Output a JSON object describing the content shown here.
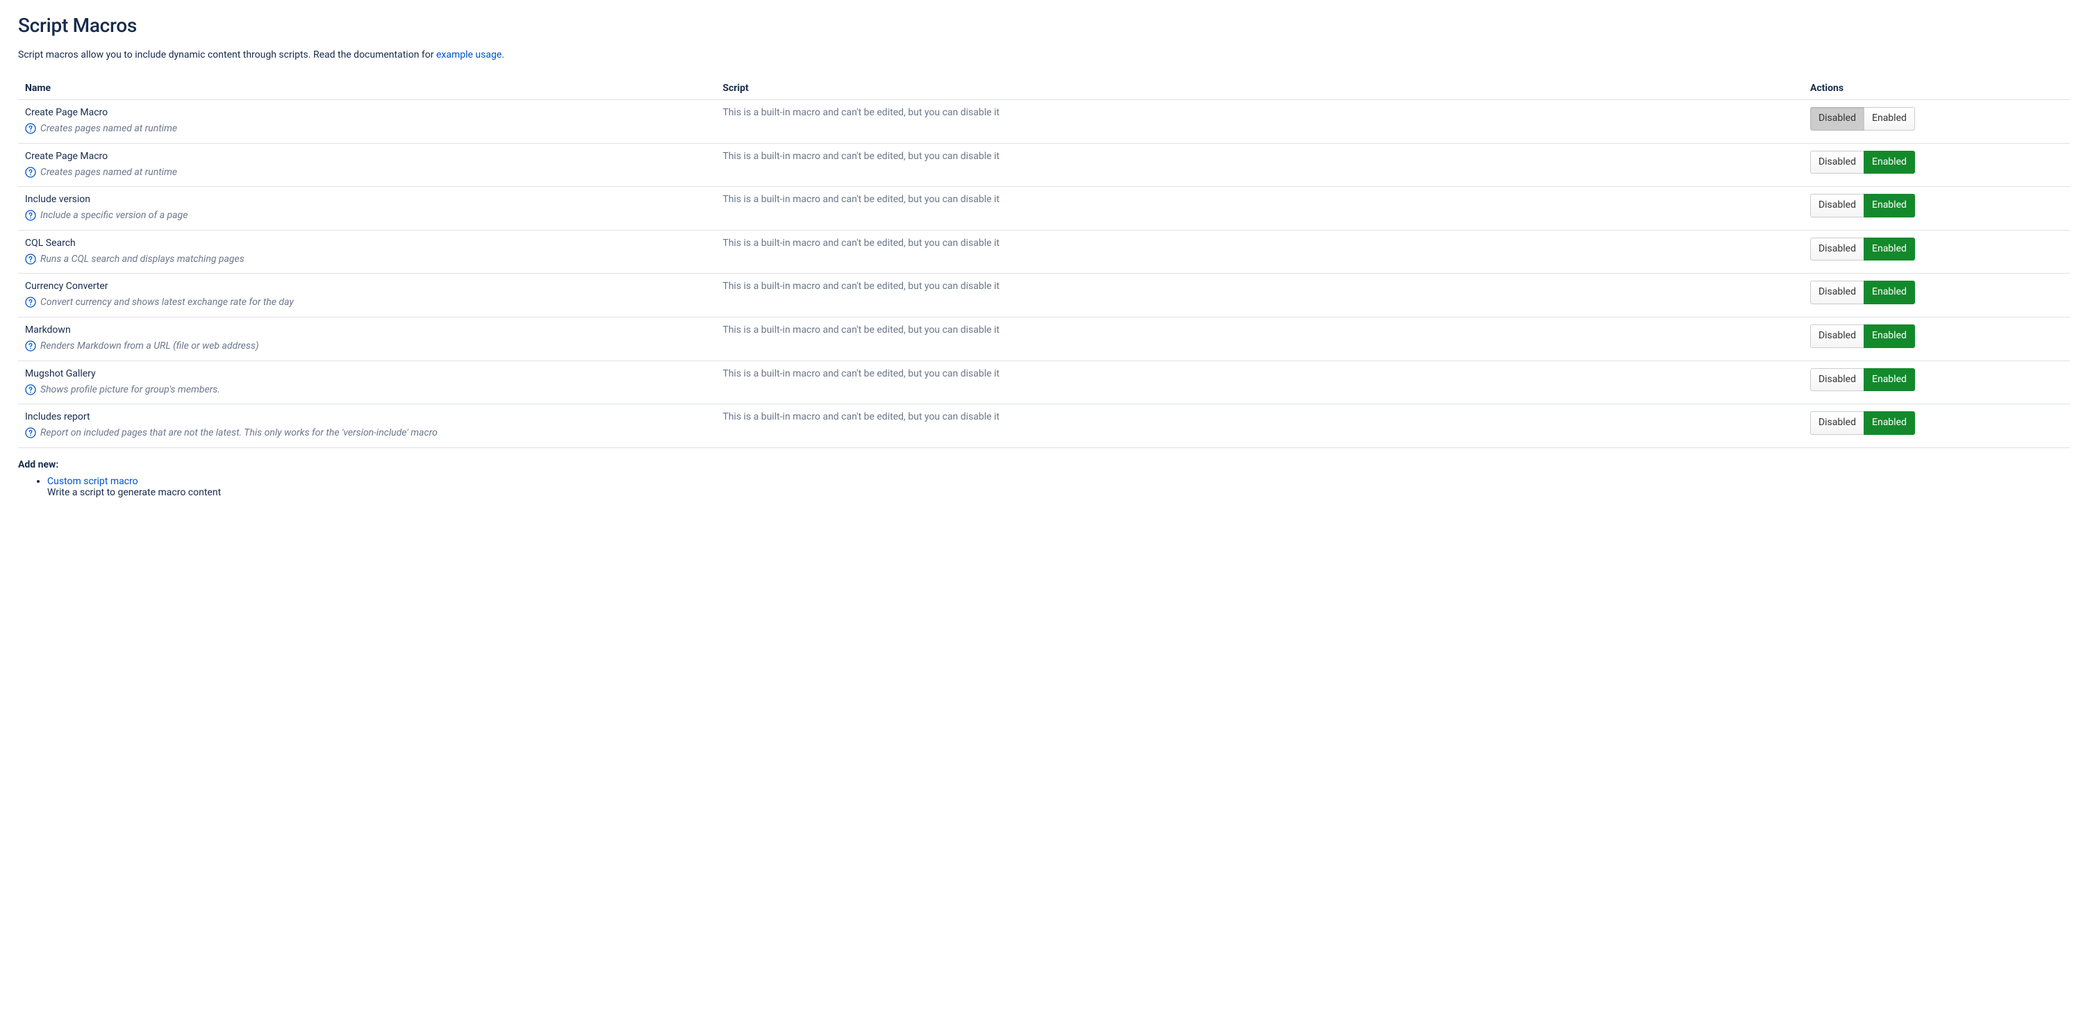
{
  "page": {
    "title": "Script Macros",
    "intro_prefix": "Script macros allow you to include dynamic content through scripts. Read the documentation for ",
    "intro_link": "example usage",
    "intro_suffix": "."
  },
  "columns": {
    "name": "Name",
    "script": "Script",
    "actions": "Actions"
  },
  "buttons": {
    "disabled": "Disabled",
    "enabled": "Enabled"
  },
  "macros": [
    {
      "name": "Create Page Macro",
      "description": "Creates pages named at runtime",
      "script": "This is a built-in macro and can't be edited, but you can disable it",
      "state": "disabled"
    },
    {
      "name": "Create Page Macro",
      "description": "Creates pages named at runtime",
      "script": "This is a built-in macro and can't be edited, but you can disable it",
      "state": "enabled"
    },
    {
      "name": "Include version",
      "description": "Include a specific version of a page",
      "script": "This is a built-in macro and can't be edited, but you can disable it",
      "state": "enabled"
    },
    {
      "name": "CQL Search",
      "description": "Runs a CQL search and displays matching pages",
      "script": "This is a built-in macro and can't be edited, but you can disable it",
      "state": "enabled"
    },
    {
      "name": "Currency Converter",
      "description": "Convert currency and shows latest exchange rate for the day",
      "script": "This is a built-in macro and can't be edited, but you can disable it",
      "state": "enabled"
    },
    {
      "name": "Markdown",
      "description": "Renders Markdown from a URL (file or web address)",
      "script": "This is a built-in macro and can't be edited, but you can disable it",
      "state": "enabled"
    },
    {
      "name": "Mugshot Gallery",
      "description": "Shows profile picture for group's members.",
      "script": "This is a built-in macro and can't be edited, but you can disable it",
      "state": "enabled"
    },
    {
      "name": "Includes report",
      "description": "Report on included pages that are not the latest. This only works for the 'version-include' macro",
      "script": "This is a built-in macro and can't be edited, but you can disable it",
      "state": "enabled"
    }
  ],
  "add_new": {
    "label": "Add new:",
    "items": [
      {
        "link": "Custom script macro",
        "sub": "Write a script to generate macro content"
      }
    ]
  }
}
